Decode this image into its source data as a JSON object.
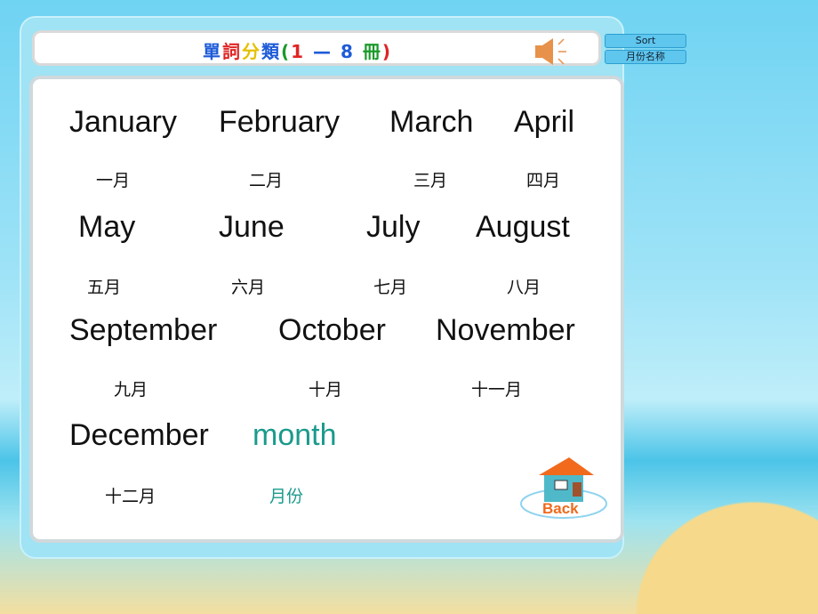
{
  "title": {
    "chars": [
      {
        "t": "單",
        "c": "#1e5bd8"
      },
      {
        "t": "詞",
        "c": "#e02424"
      },
      {
        "t": "分",
        "c": "#e5c000"
      },
      {
        "t": "類",
        "c": "#1e5bd8"
      },
      {
        "t": "(",
        "c": "#1a9a2a"
      },
      {
        "t": "1",
        "c": "#e02424"
      },
      {
        "t": " — ",
        "c": "#1e5bd8"
      },
      {
        "t": "8",
        "c": "#1e5bd8"
      },
      {
        "t": " 冊",
        "c": "#1a9a2a"
      },
      {
        "t": ")",
        "c": "#e02424"
      }
    ]
  },
  "side": {
    "sort": "Sort",
    "category": "月份名称"
  },
  "words": [
    {
      "en": "January",
      "zh": "一月"
    },
    {
      "en": "February",
      "zh": "二月"
    },
    {
      "en": "March",
      "zh": "三月"
    },
    {
      "en": "April",
      "zh": "四月"
    },
    {
      "en": "May",
      "zh": "五月"
    },
    {
      "en": "June",
      "zh": "六月"
    },
    {
      "en": "July",
      "zh": "七月"
    },
    {
      "en": "August",
      "zh": "八月"
    },
    {
      "en": "September",
      "zh": "九月"
    },
    {
      "en": "October",
      "zh": "十月"
    },
    {
      "en": "November",
      "zh": "十一月"
    },
    {
      "en": "December",
      "zh": "十二月"
    },
    {
      "en": "month",
      "zh": "月份"
    }
  ],
  "back_label": "Back",
  "colors": {
    "highlight": "#1a9a8c",
    "back": "#ef6a1c"
  },
  "icons": {
    "speaker": "speaker-icon",
    "back": "house-icon"
  }
}
